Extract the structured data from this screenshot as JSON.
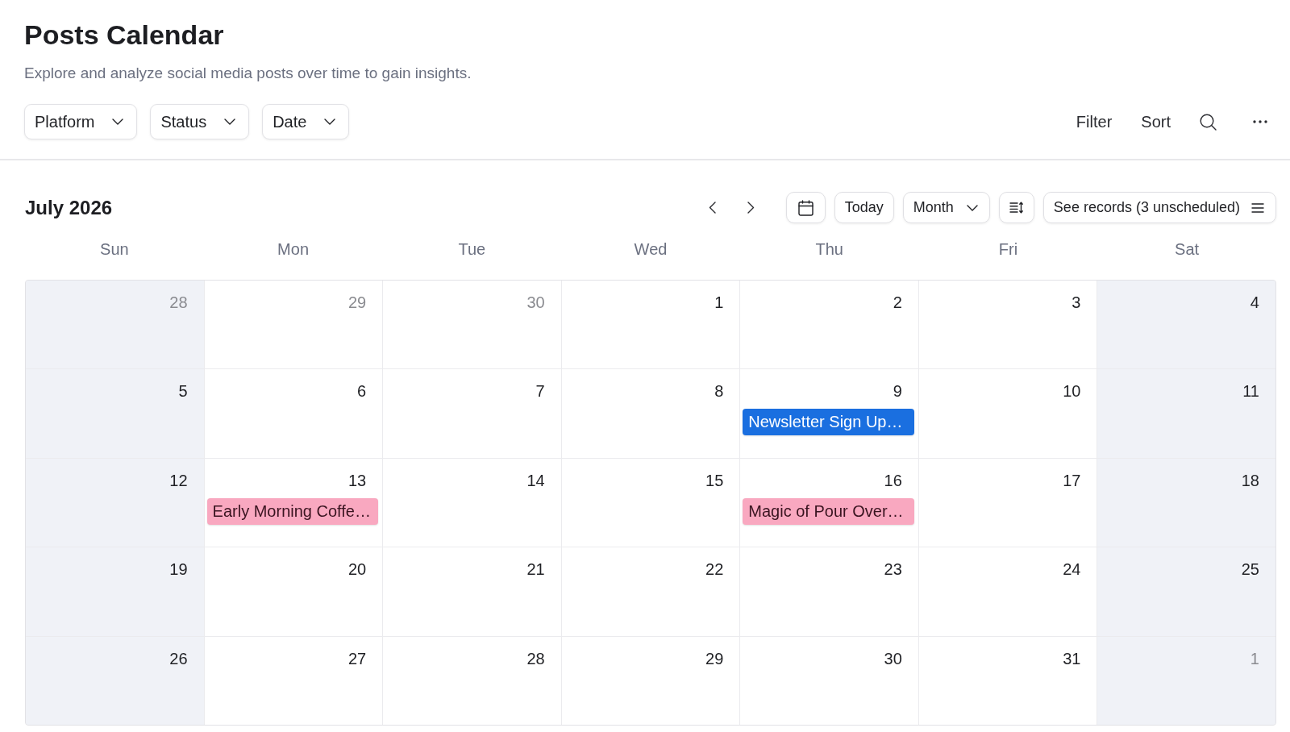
{
  "header": {
    "title": "Posts Calendar",
    "subtitle": "Explore and analyze social media posts over time to gain insights."
  },
  "filters": [
    {
      "label": "Platform"
    },
    {
      "label": "Status"
    },
    {
      "label": "Date"
    }
  ],
  "actions": [
    {
      "label": "Filter"
    },
    {
      "label": "Sort"
    }
  ],
  "calendar": {
    "title": "July 2026",
    "today_button": "Today",
    "view": "Month",
    "records_button": "See records (3 unscheduled)",
    "weekdays": [
      {
        "label": "Sun",
        "weekend": true
      },
      {
        "label": "Mon",
        "weekend": false
      },
      {
        "label": "Tue",
        "weekend": false
      },
      {
        "label": "Wed",
        "weekend": false
      },
      {
        "label": "Thu",
        "weekend": false
      },
      {
        "label": "Fri",
        "weekend": false
      },
      {
        "label": "Sat",
        "weekend": true
      }
    ],
    "weeks": [
      {
        "days": [
          {
            "day": "28",
            "in_month": false
          },
          {
            "day": "29",
            "in_month": false
          },
          {
            "day": "30",
            "in_month": false
          },
          {
            "day": "1",
            "in_month": true
          },
          {
            "day": "2",
            "in_month": true
          },
          {
            "day": "3",
            "in_month": true
          },
          {
            "day": "4",
            "in_month": true
          }
        ]
      },
      {
        "days": [
          {
            "day": "5",
            "in_month": true
          },
          {
            "day": "6",
            "in_month": true
          },
          {
            "day": "7",
            "in_month": true
          },
          {
            "day": "8",
            "in_month": true
          },
          {
            "day": "9",
            "in_month": true,
            "events": [
              {
                "title": "Newsletter Sign Up…",
                "color": "#1a6fe0"
              }
            ]
          },
          {
            "day": "10",
            "in_month": true
          },
          {
            "day": "11",
            "in_month": true
          }
        ]
      },
      {
        "days": [
          {
            "day": "12",
            "in_month": true
          },
          {
            "day": "13",
            "in_month": true,
            "events": [
              {
                "title": "Early Morning Coffe…",
                "color": "#f9a8c0"
              }
            ]
          },
          {
            "day": "14",
            "in_month": true
          },
          {
            "day": "15",
            "in_month": true
          },
          {
            "day": "16",
            "in_month": true,
            "events": [
              {
                "title": "Magic of Pour Over…",
                "color": "#f9a8c0"
              }
            ]
          },
          {
            "day": "17",
            "in_month": true
          },
          {
            "day": "18",
            "in_month": true
          }
        ]
      },
      {
        "days": [
          {
            "day": "19",
            "in_month": true
          },
          {
            "day": "20",
            "in_month": true
          },
          {
            "day": "21",
            "in_month": true
          },
          {
            "day": "22",
            "in_month": true
          },
          {
            "day": "23",
            "in_month": true
          },
          {
            "day": "24",
            "in_month": true
          },
          {
            "day": "25",
            "in_month": true
          }
        ]
      },
      {
        "days": [
          {
            "day": "26",
            "in_month": true
          },
          {
            "day": "27",
            "in_month": true
          },
          {
            "day": "28",
            "in_month": true
          },
          {
            "day": "29",
            "in_month": true
          },
          {
            "day": "30",
            "in_month": true
          },
          {
            "day": "31",
            "in_month": true
          },
          {
            "day": "1",
            "in_month": false
          }
        ]
      }
    ]
  }
}
